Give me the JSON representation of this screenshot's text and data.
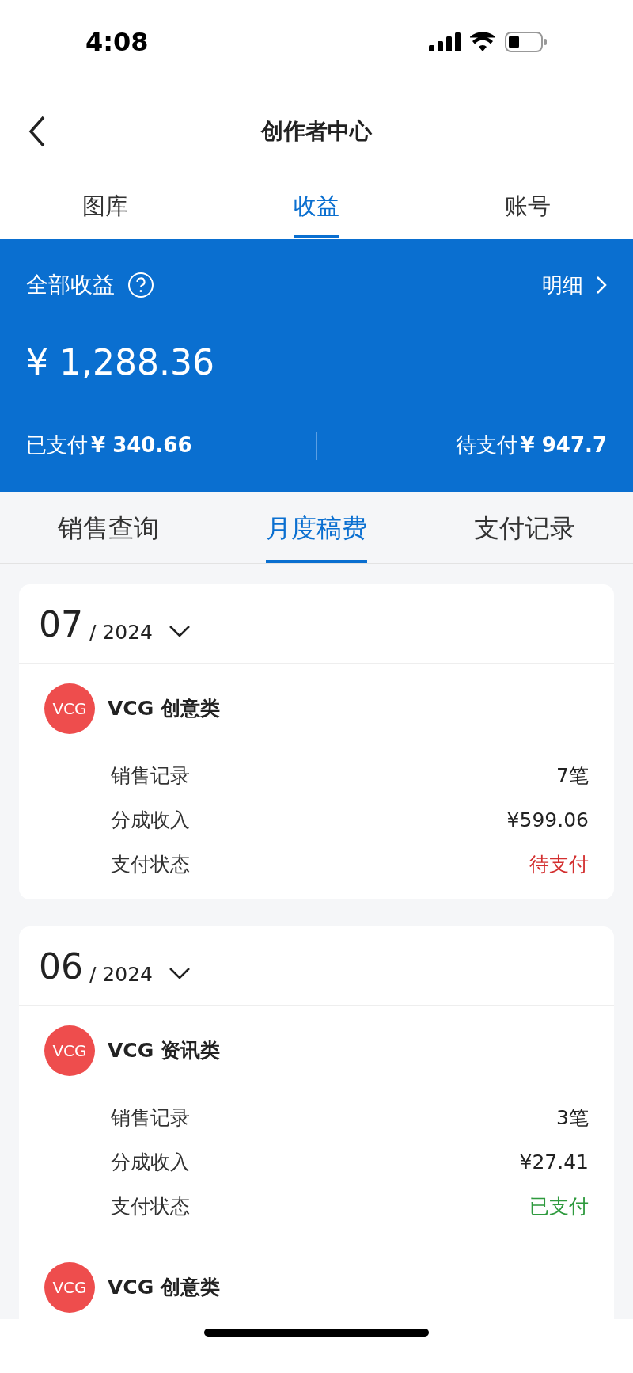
{
  "status_bar": {
    "time": "4:08"
  },
  "header": {
    "title": "创作者中心"
  },
  "tabs": [
    {
      "label": "图库",
      "selected": false
    },
    {
      "label": "收益",
      "selected": true
    },
    {
      "label": "账号",
      "selected": false
    }
  ],
  "summary": {
    "label": "全部收益",
    "detail_link": "明细",
    "amount": "¥ 1,288.36",
    "paid_label": "已支付",
    "paid_amount": "¥ 340.66",
    "pending_label": "待支付",
    "pending_amount": "¥ 947.7"
  },
  "subtabs": [
    {
      "label": "销售查询",
      "selected": false
    },
    {
      "label": "月度稿费",
      "selected": true
    },
    {
      "label": "支付记录",
      "selected": false
    }
  ],
  "months": [
    {
      "month": "07",
      "year": "/ 2024",
      "entries": [
        {
          "badge": "VCG",
          "name": "VCG 创意类",
          "rows": [
            {
              "label": "销售记录",
              "value": "7笔",
              "kind": "plain"
            },
            {
              "label": "分成收入",
              "value": "¥599.06",
              "kind": "plain"
            },
            {
              "label": "支付状态",
              "value": "待支付",
              "kind": "pending"
            }
          ]
        }
      ]
    },
    {
      "month": "06",
      "year": "/ 2024",
      "entries": [
        {
          "badge": "VCG",
          "name": "VCG 资讯类",
          "rows": [
            {
              "label": "销售记录",
              "value": "3笔",
              "kind": "plain"
            },
            {
              "label": "分成收入",
              "value": "¥27.41",
              "kind": "plain"
            },
            {
              "label": "支付状态",
              "value": "已支付",
              "kind": "paid"
            }
          ]
        },
        {
          "badge": "VCG",
          "name": "VCG 创意类"
        }
      ]
    }
  ]
}
